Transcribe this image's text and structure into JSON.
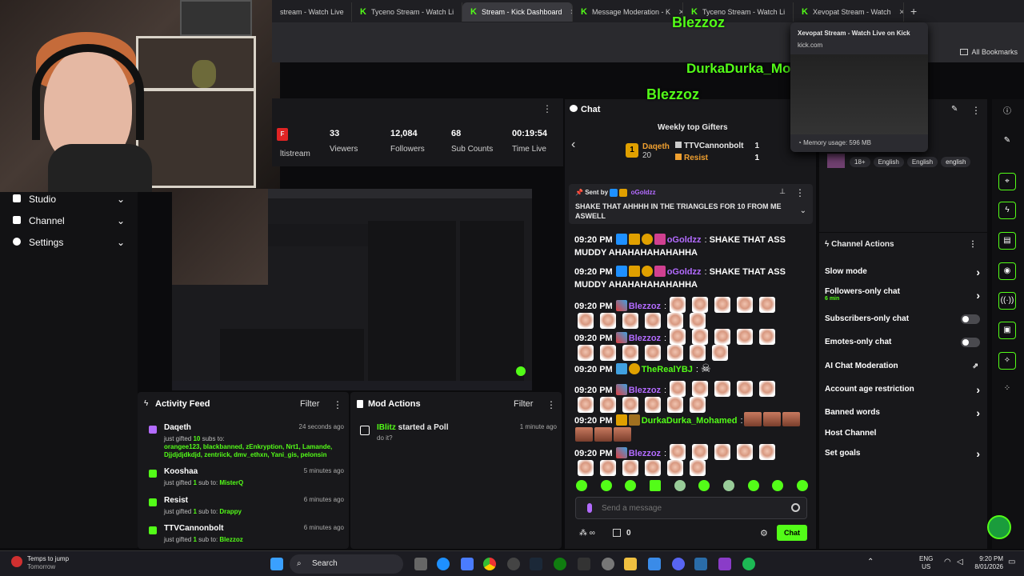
{
  "browser": {
    "tabs": [
      {
        "label": "stream - Watch Live",
        "active": false
      },
      {
        "label": "Tyceno Stream - Watch Li",
        "active": false
      },
      {
        "label": "Stream - Kick Dashboard",
        "active": true
      },
      {
        "label": "Message Moderation - K",
        "active": false
      },
      {
        "label": "Tyceno Stream - Watch Li",
        "active": false
      },
      {
        "label": "Xevopat Stream - Watch",
        "active": false
      }
    ],
    "bookmarks_label": "All Bookmarks",
    "tab_preview": {
      "title": "Xevopat Stream - Watch Live on Kick",
      "url": "kick.com",
      "memory": "Memory usage: 596 MB"
    }
  },
  "left_nav": {
    "items": [
      {
        "label": "Studio"
      },
      {
        "label": "Channel"
      },
      {
        "label": "Settings"
      }
    ]
  },
  "stats": {
    "multistream_label": "ltistream",
    "items": [
      {
        "value": "33",
        "label": "Viewers"
      },
      {
        "value": "12,084",
        "label": "Followers"
      },
      {
        "value": "68",
        "label": "Sub Counts"
      },
      {
        "value": "00:19:54",
        "label": "Time Live"
      }
    ]
  },
  "activity_feed": {
    "title": "Activity Feed",
    "filter_label": "Filter",
    "items": [
      {
        "name": "Daqeth",
        "time": "24 seconds ago",
        "text_pre": "just gifted ",
        "count": "10",
        "text_mid": " subs to:",
        "recipients": "orangee123, blackbanned, zEnkryption, Nrt1, Lamande, Djjdjdjdkdjd, zentriick, dmv_ethxn, Yani_gis, pelonsin"
      },
      {
        "name": "Kooshaa",
        "time": "5 minutes ago",
        "text_pre": "just gifted ",
        "count": "1",
        "text_mid": " sub to: ",
        "recipients": "MisterQ"
      },
      {
        "name": "Resist",
        "time": "6 minutes ago",
        "text_pre": "just gifted ",
        "count": "1",
        "text_mid": " sub to: ",
        "recipients": "Drappy"
      },
      {
        "name": "TTVCannonbolt",
        "time": "6 minutes ago",
        "text_pre": "just gifted ",
        "count": "1",
        "text_mid": " sub to: ",
        "recipients": "Blezzoz"
      }
    ]
  },
  "mod_actions": {
    "title": "Mod Actions",
    "filter_label": "Filter",
    "items": [
      {
        "name": "IBlitz",
        "action": "started a Poll",
        "sub": "do it?",
        "time": "1 minute ago"
      }
    ]
  },
  "chat": {
    "title": "Chat",
    "gifters_title": "Weekly top Gifters",
    "gifters": [
      {
        "rank": "1",
        "name": "Daqeth",
        "count": "20"
      },
      {
        "rank": "",
        "name": "TTVCannonbolt",
        "count": "1"
      },
      {
        "rank": "",
        "name": "Resist",
        "count": "1"
      }
    ],
    "pinned": {
      "sent_by": "Sent by",
      "user": "oGoldzz",
      "text": "SHAKE THAT AHHHH IN THE TRIANGLES FOR 10 FROM ME ASWELL"
    },
    "messages": [
      {
        "time": "09:20 PM",
        "user": "oGoldzz",
        "color": "#b36bff",
        "text": "SHAKE THAT ASS MUDDY AHAHAHAHAHAHHA"
      },
      {
        "time": "09:20 PM",
        "user": "oGoldzz",
        "color": "#b36bff",
        "text": "SHAKE THAT ASS MUDDY AHAHAHAHAHAHHA"
      },
      {
        "time": "09:20 PM",
        "user": "Blezzoz",
        "color": "#b36bff",
        "text": ""
      },
      {
        "time": "09:20 PM",
        "user": "Blezzoz",
        "color": "#b36bff",
        "text": ""
      },
      {
        "time": "09:20 PM",
        "user": "TheRealYBJ",
        "color": "#53fc18",
        "text": ""
      },
      {
        "time": "09:20 PM",
        "user": "Blezzoz",
        "color": "#b36bff",
        "text": ""
      },
      {
        "time": "09:20 PM",
        "user": "DurkaDurka_Mohamed",
        "color": "#53fc18",
        "text": ""
      },
      {
        "time": "09:20 PM",
        "user": "Blezzoz",
        "color": "#b36bff",
        "text": ""
      }
    ],
    "input_placeholder": "Send a message",
    "chat_button": "Chat",
    "footer_count": "0",
    "overlay_names": [
      "Blezzoz",
      "DurkaDurka_Mohamed",
      "Blezzoz"
    ]
  },
  "channel_actions": {
    "title": "Channel Actions",
    "tags": [
      "18+",
      "English",
      "English",
      "english"
    ],
    "items": [
      {
        "label": "Slow mode",
        "sub": "",
        "control": "chevron"
      },
      {
        "label": "Followers-only chat",
        "sub": "6 min",
        "control": "chevron"
      },
      {
        "label": "Subscribers-only chat",
        "sub": "",
        "control": "toggle"
      },
      {
        "label": "Emotes-only chat",
        "sub": "",
        "control": "toggle"
      },
      {
        "label": "AI Chat Moderation",
        "sub": "",
        "control": "external"
      },
      {
        "label": "Account age restriction",
        "sub": "",
        "control": "chevron"
      },
      {
        "label": "Banned words",
        "sub": "",
        "control": "chevron"
      },
      {
        "label": "Host Channel",
        "sub": "",
        "control": "none"
      },
      {
        "label": "Set goals",
        "sub": "",
        "control": "chevron"
      }
    ]
  },
  "taskbar": {
    "weather_title": "Temps to jump",
    "weather_sub": "Tomorrow",
    "search_label": "Search",
    "lang": "ENG",
    "region": "US",
    "time": "9:20 PM",
    "date": "8/01/2026"
  },
  "colors": {
    "accent": "#53fc18",
    "panel": "#18181b",
    "bg": "#0b0b0d"
  }
}
